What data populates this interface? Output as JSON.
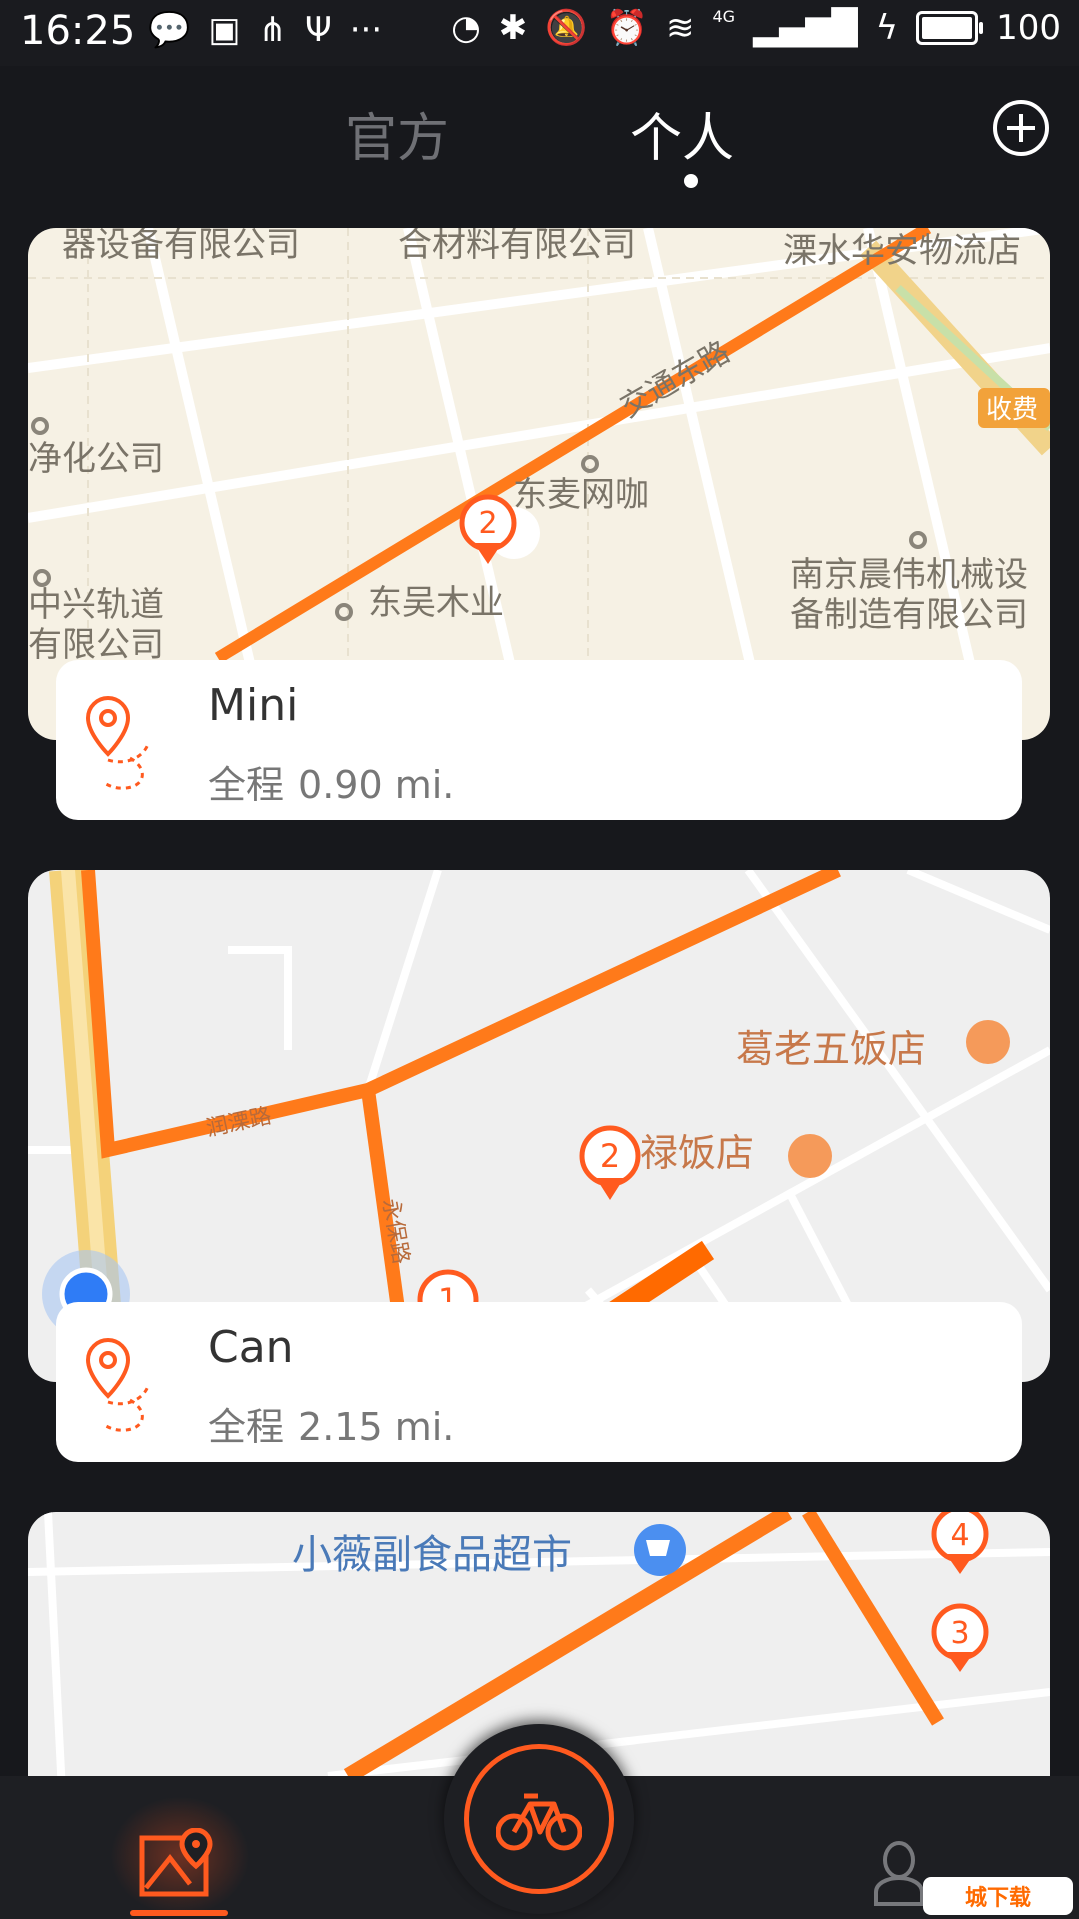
{
  "status_bar": {
    "time": "16:25",
    "network": "4G",
    "battery": "100",
    "battery_fraction": 1.0
  },
  "header": {
    "tabs": [
      {
        "label": "官方",
        "active": false
      },
      {
        "label": "个人",
        "active": true
      }
    ],
    "add_icon": "plus-circle-icon"
  },
  "routes": [
    {
      "name": "Mini",
      "distance_label": "全程",
      "distance": "0.90 mi.",
      "map_labels": [
        "器设备有限公司",
        "合材料有限公司",
        "溧水华安物流店",
        "交通东路",
        "收费",
        "净化公司",
        "东麦网咖",
        "南京晨伟机械设",
        "备制造有限公司",
        "中兴轨道",
        "有限公司",
        "东吴木业"
      ],
      "markers": [
        "2"
      ]
    },
    {
      "name": "Can",
      "distance_label": "全程",
      "distance": "2.15 mi.",
      "map_labels": [
        "葛老五饭店",
        "润溧路",
        "禄饭店",
        "永保路"
      ],
      "markers": [
        "2",
        "1"
      ]
    },
    {
      "name": "",
      "distance_label": "",
      "distance": "",
      "map_labels": [
        "小薇副食品超市"
      ],
      "markers": [
        "4",
        "3"
      ]
    }
  ],
  "bottom_nav": {
    "items": [
      {
        "icon": "map-route-icon",
        "active": true
      },
      {
        "icon": "bicycle-icon",
        "active": false
      },
      {
        "icon": "user-icon",
        "active": false
      }
    ]
  },
  "watermark": "城下载",
  "colors": {
    "accent": "#ff5a1f",
    "route": "#ff7a1a",
    "background": "#17181c"
  }
}
